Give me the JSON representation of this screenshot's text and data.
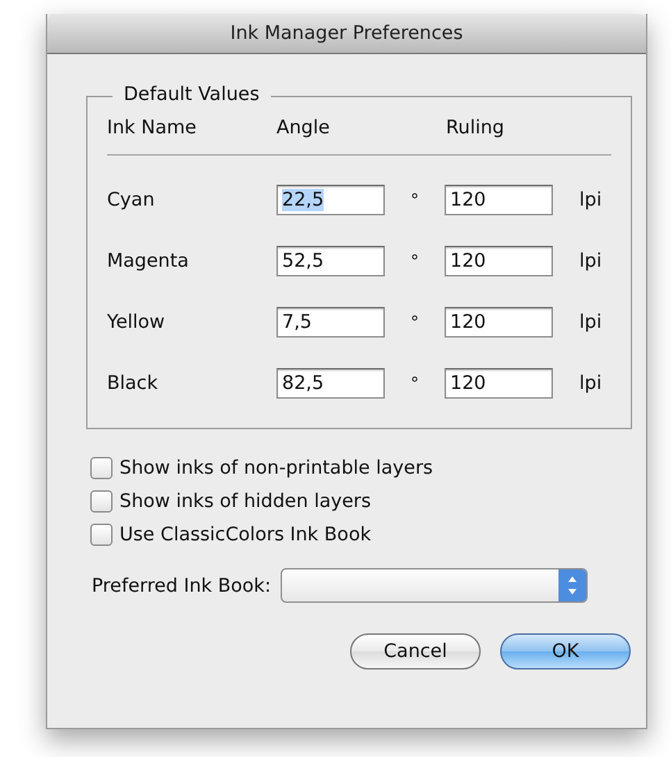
{
  "window": {
    "title": "Ink Manager Preferences"
  },
  "group": {
    "title": "Default Values",
    "columns": [
      "Ink Name",
      "Angle",
      "Ruling"
    ],
    "inks": [
      {
        "name": "Cyan",
        "angle": "22,5",
        "angle_selected": true,
        "degree": "°",
        "ruling": "120",
        "unit": "lpi"
      },
      {
        "name": "Magenta",
        "angle": "52,5",
        "angle_selected": false,
        "degree": "°",
        "ruling": "120",
        "unit": "lpi"
      },
      {
        "name": "Yellow",
        "angle": "7,5",
        "angle_selected": false,
        "degree": "°",
        "ruling": "120",
        "unit": "lpi"
      },
      {
        "name": "Black",
        "angle": "82,5",
        "angle_selected": false,
        "degree": "°",
        "ruling": "120",
        "unit": "lpi"
      }
    ]
  },
  "options": [
    {
      "label": "Show inks of non-printable layers",
      "checked": false
    },
    {
      "label": "Show inks of hidden layers",
      "checked": false
    },
    {
      "label": "Use ClassicColors Ink Book",
      "checked": false
    }
  ],
  "preferred_ink_book": {
    "label": "Preferred Ink Book:"
  },
  "buttons": [
    {
      "label": "Cancel",
      "default": false
    },
    {
      "label": "OK",
      "default": true
    }
  ]
}
